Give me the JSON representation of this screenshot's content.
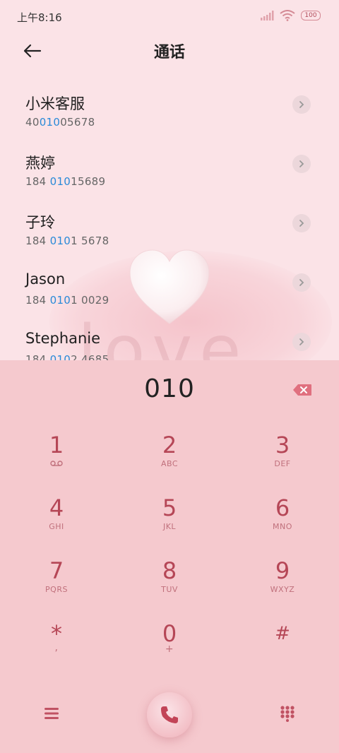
{
  "status": {
    "time": "上午8:16",
    "battery": "100"
  },
  "header": {
    "title": "通话"
  },
  "contacts": [
    {
      "name": "小米客服",
      "num_pre": "40",
      "num_hl": "010",
      "num_post": "05678"
    },
    {
      "name": "燕婷",
      "num_pre": "184 ",
      "num_hl": "010",
      "num_post": "15689"
    },
    {
      "name": "子玲",
      "num_pre": "184 ",
      "num_hl": "010",
      "num_post": "1 5678"
    },
    {
      "name": "Jason",
      "num_pre": "184 ",
      "num_hl": "010",
      "num_post": "1 0029"
    },
    {
      "name": "Stephanie",
      "num_pre": "184 ",
      "num_hl": "010",
      "num_post": "2 4685"
    }
  ],
  "background": {
    "text": "love"
  },
  "dialer": {
    "entered": "010",
    "keys": [
      {
        "digit": "1",
        "letters": "voicemail"
      },
      {
        "digit": "2",
        "letters": "ABC"
      },
      {
        "digit": "3",
        "letters": "DEF"
      },
      {
        "digit": "4",
        "letters": "GHI"
      },
      {
        "digit": "5",
        "letters": "JKL"
      },
      {
        "digit": "6",
        "letters": "MNO"
      },
      {
        "digit": "7",
        "letters": "PQRS"
      },
      {
        "digit": "8",
        "letters": "TUV"
      },
      {
        "digit": "9",
        "letters": "WXYZ"
      },
      {
        "digit": "*",
        "letters": ","
      },
      {
        "digit": "0",
        "letters": "+"
      },
      {
        "digit": "#",
        "letters": ""
      }
    ]
  },
  "colors": {
    "accent": "#b54656",
    "highlight": "#2a8ad8",
    "keypad_bg": "#f5c9ce",
    "page_bg": "#fbe3e7"
  }
}
